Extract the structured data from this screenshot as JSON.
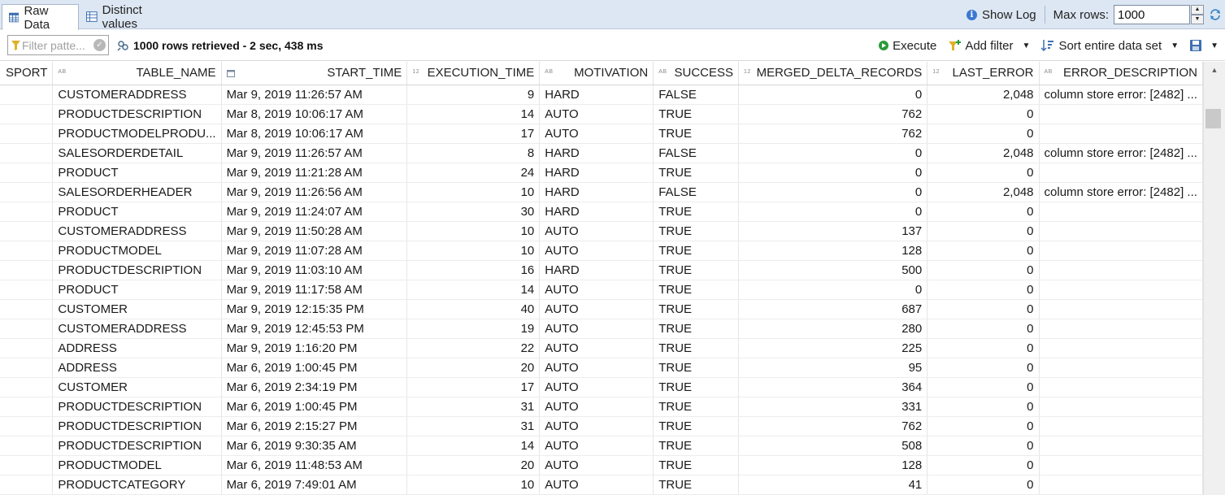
{
  "tabs": {
    "raw_label": "Raw Data",
    "distinct_label": "Distinct values"
  },
  "header_right": {
    "show_log_label": "Show Log",
    "max_rows_label": "Max rows:",
    "max_rows_value": "1000"
  },
  "toolbar": {
    "filter_placeholder": "Filter patte...",
    "status_text": "1000 rows retrieved - 2 sec, 438 ms",
    "execute_label": "Execute",
    "add_filter_label": "Add filter",
    "sort_label": "Sort entire data set"
  },
  "colors": {
    "tabbar_bg": "#dde7f3",
    "execute_green": "#2b9a3a",
    "info_blue": "#3b78d1"
  },
  "columns": [
    {
      "name": "SPORT",
      "type": ""
    },
    {
      "name": "TABLE_NAME",
      "type": "AB"
    },
    {
      "name": "START_TIME",
      "type": "cal"
    },
    {
      "name": "EXECUTION_TIME",
      "type": "12"
    },
    {
      "name": "MOTIVATION",
      "type": "AB"
    },
    {
      "name": "SUCCESS",
      "type": "AB"
    },
    {
      "name": "MERGED_DELTA_RECORDS",
      "type": "12"
    },
    {
      "name": "LAST_ERROR",
      "type": "12"
    },
    {
      "name": "ERROR_DESCRIPTION",
      "type": "AB"
    }
  ],
  "rows": [
    [
      "",
      "CUSTOMERADDRESS",
      "Mar 9, 2019 11:26:57 AM",
      "9",
      "HARD",
      "FALSE",
      "0",
      "2,048",
      "column store error: [2482] ..."
    ],
    [
      "",
      "PRODUCTDESCRIPTION",
      "Mar 8, 2019 10:06:17 AM",
      "14",
      "AUTO",
      "TRUE",
      "762",
      "0",
      ""
    ],
    [
      "",
      "PRODUCTMODELPRODU...",
      "Mar 8, 2019 10:06:17 AM",
      "17",
      "AUTO",
      "TRUE",
      "762",
      "0",
      ""
    ],
    [
      "",
      "SALESORDERDETAIL",
      "Mar 9, 2019 11:26:57 AM",
      "8",
      "HARD",
      "FALSE",
      "0",
      "2,048",
      "column store error: [2482] ..."
    ],
    [
      "",
      "PRODUCT",
      "Mar 9, 2019 11:21:28 AM",
      "24",
      "HARD",
      "TRUE",
      "0",
      "0",
      ""
    ],
    [
      "",
      "SALESORDERHEADER",
      "Mar 9, 2019 11:26:56 AM",
      "10",
      "HARD",
      "FALSE",
      "0",
      "2,048",
      "column store error: [2482] ..."
    ],
    [
      "",
      "PRODUCT",
      "Mar 9, 2019 11:24:07 AM",
      "30",
      "HARD",
      "TRUE",
      "0",
      "0",
      ""
    ],
    [
      "",
      "CUSTOMERADDRESS",
      "Mar 9, 2019 11:50:28 AM",
      "10",
      "AUTO",
      "TRUE",
      "137",
      "0",
      ""
    ],
    [
      "",
      "PRODUCTMODEL",
      "Mar 9, 2019 11:07:28 AM",
      "10",
      "AUTO",
      "TRUE",
      "128",
      "0",
      ""
    ],
    [
      "",
      "PRODUCTDESCRIPTION",
      "Mar 9, 2019 11:03:10 AM",
      "16",
      "HARD",
      "TRUE",
      "500",
      "0",
      ""
    ],
    [
      "",
      "PRODUCT",
      "Mar 9, 2019 11:17:58 AM",
      "14",
      "AUTO",
      "TRUE",
      "0",
      "0",
      ""
    ],
    [
      "",
      "CUSTOMER",
      "Mar 9, 2019 12:15:35 PM",
      "40",
      "AUTO",
      "TRUE",
      "687",
      "0",
      ""
    ],
    [
      "",
      "CUSTOMERADDRESS",
      "Mar 9, 2019 12:45:53 PM",
      "19",
      "AUTO",
      "TRUE",
      "280",
      "0",
      ""
    ],
    [
      "",
      "ADDRESS",
      "Mar 9, 2019 1:16:20 PM",
      "22",
      "AUTO",
      "TRUE",
      "225",
      "0",
      ""
    ],
    [
      "",
      "ADDRESS",
      "Mar 6, 2019 1:00:45 PM",
      "20",
      "AUTO",
      "TRUE",
      "95",
      "0",
      ""
    ],
    [
      "",
      "CUSTOMER",
      "Mar 6, 2019 2:34:19 PM",
      "17",
      "AUTO",
      "TRUE",
      "364",
      "0",
      ""
    ],
    [
      "",
      "PRODUCTDESCRIPTION",
      "Mar 6, 2019 1:00:45 PM",
      "31",
      "AUTO",
      "TRUE",
      "331",
      "0",
      ""
    ],
    [
      "",
      "PRODUCTDESCRIPTION",
      "Mar 6, 2019 2:15:27 PM",
      "31",
      "AUTO",
      "TRUE",
      "762",
      "0",
      ""
    ],
    [
      "",
      "PRODUCTDESCRIPTION",
      "Mar 6, 2019 9:30:35 AM",
      "14",
      "AUTO",
      "TRUE",
      "508",
      "0",
      ""
    ],
    [
      "",
      "PRODUCTMODEL",
      "Mar 6, 2019 11:48:53 AM",
      "20",
      "AUTO",
      "TRUE",
      "128",
      "0",
      ""
    ],
    [
      "",
      "PRODUCTCATEGORY",
      "Mar 6, 2019 7:49:01 AM",
      "10",
      "AUTO",
      "TRUE",
      "41",
      "0",
      ""
    ]
  ]
}
